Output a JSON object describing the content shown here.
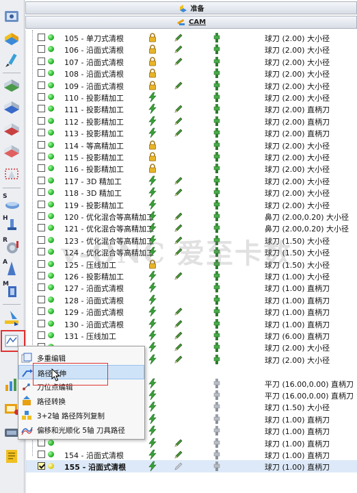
{
  "headers": {
    "prepare": "准备",
    "cam": "CAM"
  },
  "watermark": "v-ONC 爱至卡数",
  "tree": {
    "rows": [
      {
        "name": "105 - 单刀式清根",
        "status": "lock",
        "edit": true,
        "tool": "green",
        "desc": "球刀 (2.00) 大小径"
      },
      {
        "name": "106 - 沿面式清根",
        "status": "lock",
        "edit": true,
        "tool": "green",
        "desc": "球刀 (2.00) 大小径"
      },
      {
        "name": "107 - 沿面式清根",
        "status": "lock",
        "edit": true,
        "tool": "green",
        "desc": "球刀 (2.00) 大小径"
      },
      {
        "name": "108 - 沿面式清根",
        "status": "lock",
        "edit": false,
        "tool": "green",
        "desc": "球刀 (2.00) 大小径"
      },
      {
        "name": "109 - 沿面式清根",
        "status": "lock",
        "edit": true,
        "tool": "green",
        "desc": "球刀 (2.00) 大小径"
      },
      {
        "name": "110 - 投影精加工",
        "status": "bolt",
        "edit": false,
        "tool": "green",
        "desc": "球刀 (2.00) 大小径"
      },
      {
        "name": "111 - 投影精加工",
        "status": "bolt",
        "edit": true,
        "tool": "green",
        "desc": "球刀 (2.00) 直柄刀"
      },
      {
        "name": "112 - 投影精加工",
        "status": "bolt",
        "edit": true,
        "tool": "green",
        "desc": "球刀 (2.00) 直柄刀"
      },
      {
        "name": "113 - 投影精加工",
        "status": "bolt",
        "edit": true,
        "tool": "green",
        "desc": "球刀 (2.00) 直柄刀"
      },
      {
        "name": "114 - 等高精加工",
        "status": "lock",
        "edit": false,
        "tool": "green",
        "desc": "球刀 (2.00) 大小径"
      },
      {
        "name": "115 - 投影精加工",
        "status": "lock",
        "edit": false,
        "tool": "green",
        "desc": "球刀 (2.00) 大小径"
      },
      {
        "name": "116 - 投影精加工",
        "status": "lock",
        "edit": false,
        "tool": "green",
        "desc": "球刀 (2.00) 大小径"
      },
      {
        "name": "117 - 3D 精加工",
        "status": "bolt",
        "edit": true,
        "tool": "green",
        "desc": "球刀 (2.00) 大小径"
      },
      {
        "name": "118 - 3D 精加工",
        "status": "bolt",
        "edit": true,
        "tool": "green",
        "desc": "球刀 (2.00) 大小径"
      },
      {
        "name": "119 - 投影精加工",
        "status": "bolt",
        "edit": false,
        "tool": "green",
        "desc": "球刀 (2.00) 大小径"
      },
      {
        "name": "120 - 优化混合等高精加工",
        "status": "bolt",
        "edit": true,
        "tool": "green",
        "desc": "鼻刀 (2.00,0.20) 大小径"
      },
      {
        "name": "121 - 优化混合等高精加工",
        "status": "bolt",
        "edit": true,
        "tool": "green",
        "desc": "鼻刀 (2.00,0.20) 大小径"
      },
      {
        "name": "123 - 优化混合等高精加工",
        "status": "bolt",
        "edit": true,
        "tool": "green",
        "desc": "球刀 (1.50) 大小径"
      },
      {
        "name": "124 - 优化混合等高精加工",
        "status": "bolt",
        "edit": true,
        "tool": "green",
        "desc": "球刀 (1.50) 大小径"
      },
      {
        "name": "125 - 压线加工",
        "status": "lock",
        "edit": false,
        "tool": "green",
        "desc": "球刀 (1.50) 大小径"
      },
      {
        "name": "126 - 投影精加工",
        "status": "bolt",
        "edit": true,
        "tool": "green",
        "desc": "球刀 (1.00) 大小径"
      },
      {
        "name": "127 - 沿面式清根",
        "status": "bolt",
        "edit": false,
        "tool": "green",
        "desc": "球刀 (1.00) 直柄刀"
      },
      {
        "name": "128 - 沿面式清根",
        "status": "bolt",
        "edit": false,
        "tool": "green",
        "desc": "球刀 (1.00) 直柄刀"
      },
      {
        "name": "129 - 沿面式清根",
        "status": "bolt",
        "edit": true,
        "tool": "green",
        "desc": "球刀 (1.00) 直柄刀"
      },
      {
        "name": "130 - 沿面式清根",
        "status": "bolt",
        "edit": true,
        "tool": "green",
        "desc": "球刀 (1.00) 直柄刀"
      },
      {
        "name": "131 - 压线加工",
        "status": "bolt",
        "edit": true,
        "tool": "green",
        "desc": "球刀 (6.00) 直柄刀"
      },
      {
        "name": "",
        "status": "bolt",
        "edit": true,
        "tool": "green",
        "desc": "球刀 (2.00) 大小径"
      },
      {
        "name": "",
        "status": "bolt",
        "edit": true,
        "tool": "green",
        "desc": "球刀 (2.00) 大小径"
      },
      {
        "name": "",
        "status": "none",
        "edit": false,
        "tool": "none",
        "desc": ""
      },
      {
        "name": "",
        "status": "bolt",
        "edit": false,
        "tool": "gray",
        "desc": "平刀 (16.00,0.00) 直柄刀"
      },
      {
        "name": "",
        "status": "bolt",
        "edit": false,
        "tool": "gray",
        "desc": "平刀 (16.00,0.00) 直柄刀"
      },
      {
        "name": "",
        "status": "bolt",
        "edit": false,
        "tool": "gray",
        "desc": "球刀 (1.50) 大小径"
      },
      {
        "name": "",
        "status": "bolt",
        "edit": false,
        "tool": "gray",
        "desc": "球刀 (1.00) 直柄刀"
      },
      {
        "name": "",
        "status": "bolt",
        "edit": false,
        "tool": "gray",
        "desc": "球刀 (1.00) 直柄刀"
      },
      {
        "name": "",
        "status": "bolt",
        "edit": true,
        "tool": "gray",
        "desc": "球刀 (1.00) 直柄刀"
      },
      {
        "name": "154 - 沿面式清根",
        "status": "bolt",
        "edit": true,
        "tool": "gray",
        "desc": "球刀 (1.00) 直柄刀"
      },
      {
        "name": "155 - 沿面式清根",
        "status": "bolt",
        "edit": true,
        "tool": "gray",
        "desc": "球刀 (1.00) 直柄刀",
        "selected": true,
        "checked": true
      }
    ]
  },
  "context_menu": {
    "items": [
      {
        "label": "多重编辑",
        "icon": "multi-edit-icon"
      },
      {
        "label": "路径延伸",
        "icon": "path-extend-icon",
        "highlighted": true
      },
      {
        "label": "刀位点编辑",
        "icon": "tool-point-edit-icon"
      },
      {
        "label": "路径转换",
        "icon": "path-transform-icon"
      },
      {
        "label": "3+2轴 路径阵列复制",
        "icon": "array-copy-icon"
      },
      {
        "label": "偏移和光顺化 5轴 刀具路径",
        "icon": "offset-smooth-icon"
      }
    ]
  },
  "toolbar": {
    "letters": {
      "s": "S",
      "h": "H",
      "r": "R",
      "a": "A",
      "m": "M"
    }
  },
  "colors": {
    "accent": "#99c2ee",
    "outline": "#e03030",
    "selection": "#dde9f8"
  }
}
